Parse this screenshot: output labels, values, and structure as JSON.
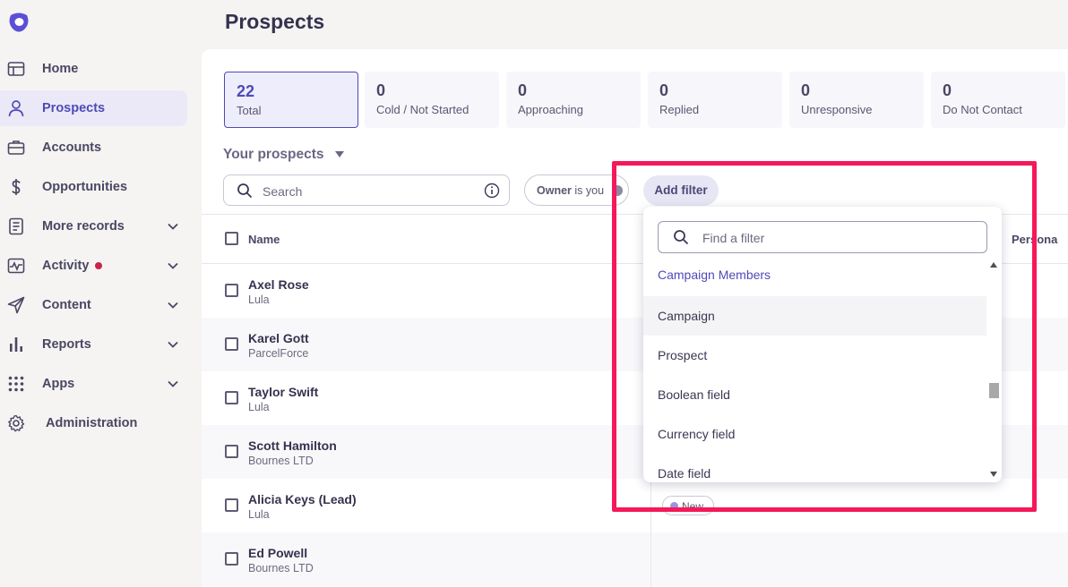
{
  "app": {
    "page_title": "Prospects",
    "logo_icon": "outreach-logo-icon",
    "accent_color": "#4f4ab8",
    "highlight_color": "#f5185a"
  },
  "sidebar": {
    "items": [
      {
        "label": "Home",
        "icon": "home-icon"
      },
      {
        "label": "Prospects",
        "icon": "person-icon",
        "active": true
      },
      {
        "label": "Accounts",
        "icon": "briefcase-icon"
      },
      {
        "label": "Opportunities",
        "icon": "dollar-icon"
      },
      {
        "label": "More records",
        "icon": "records-icon",
        "expandable": true
      },
      {
        "label": "Activity",
        "icon": "activity-icon",
        "expandable": true,
        "notification": true
      },
      {
        "label": "Content",
        "icon": "send-icon",
        "expandable": true
      },
      {
        "label": "Reports",
        "icon": "bar-chart-icon",
        "expandable": true
      },
      {
        "label": "Apps",
        "icon": "grid-icon",
        "expandable": true
      },
      {
        "label": "Administration",
        "icon": "gear-icon"
      }
    ]
  },
  "stats": [
    {
      "value": "22",
      "label": "Total",
      "active": true
    },
    {
      "value": "0",
      "label": "Cold / Not Started"
    },
    {
      "value": "0",
      "label": "Approaching"
    },
    {
      "value": "0",
      "label": "Replied"
    },
    {
      "value": "0",
      "label": "Unresponsive"
    },
    {
      "value": "0",
      "label": "Do Not Contact"
    }
  ],
  "view": {
    "title": "Your prospects"
  },
  "search": {
    "placeholder": "Search"
  },
  "owner_filter": {
    "label": "Owner",
    "value": "is you"
  },
  "add_filter": {
    "label": "Add filter"
  },
  "table": {
    "columns": {
      "name": "Name",
      "persona": "Persona"
    },
    "rows": [
      {
        "name": "Axel Rose",
        "company": "Lula"
      },
      {
        "name": "Karel Gott",
        "company": "ParcelForce"
      },
      {
        "name": "Taylor Swift",
        "company": "Lula"
      },
      {
        "name": "Scott Hamilton",
        "company": "Bournes LTD"
      },
      {
        "name": "Alicia Keys (Lead)",
        "company": "Lula"
      },
      {
        "name": "Ed Powell",
        "company": "Bournes LTD"
      }
    ],
    "badge": "New"
  },
  "filter_dropdown": {
    "search_placeholder": "Find a filter",
    "group_label": "Campaign Members",
    "items": [
      "Campaign",
      "Prospect",
      "Boolean field",
      "Currency field",
      "Date field"
    ],
    "hovered_item": "Campaign"
  }
}
